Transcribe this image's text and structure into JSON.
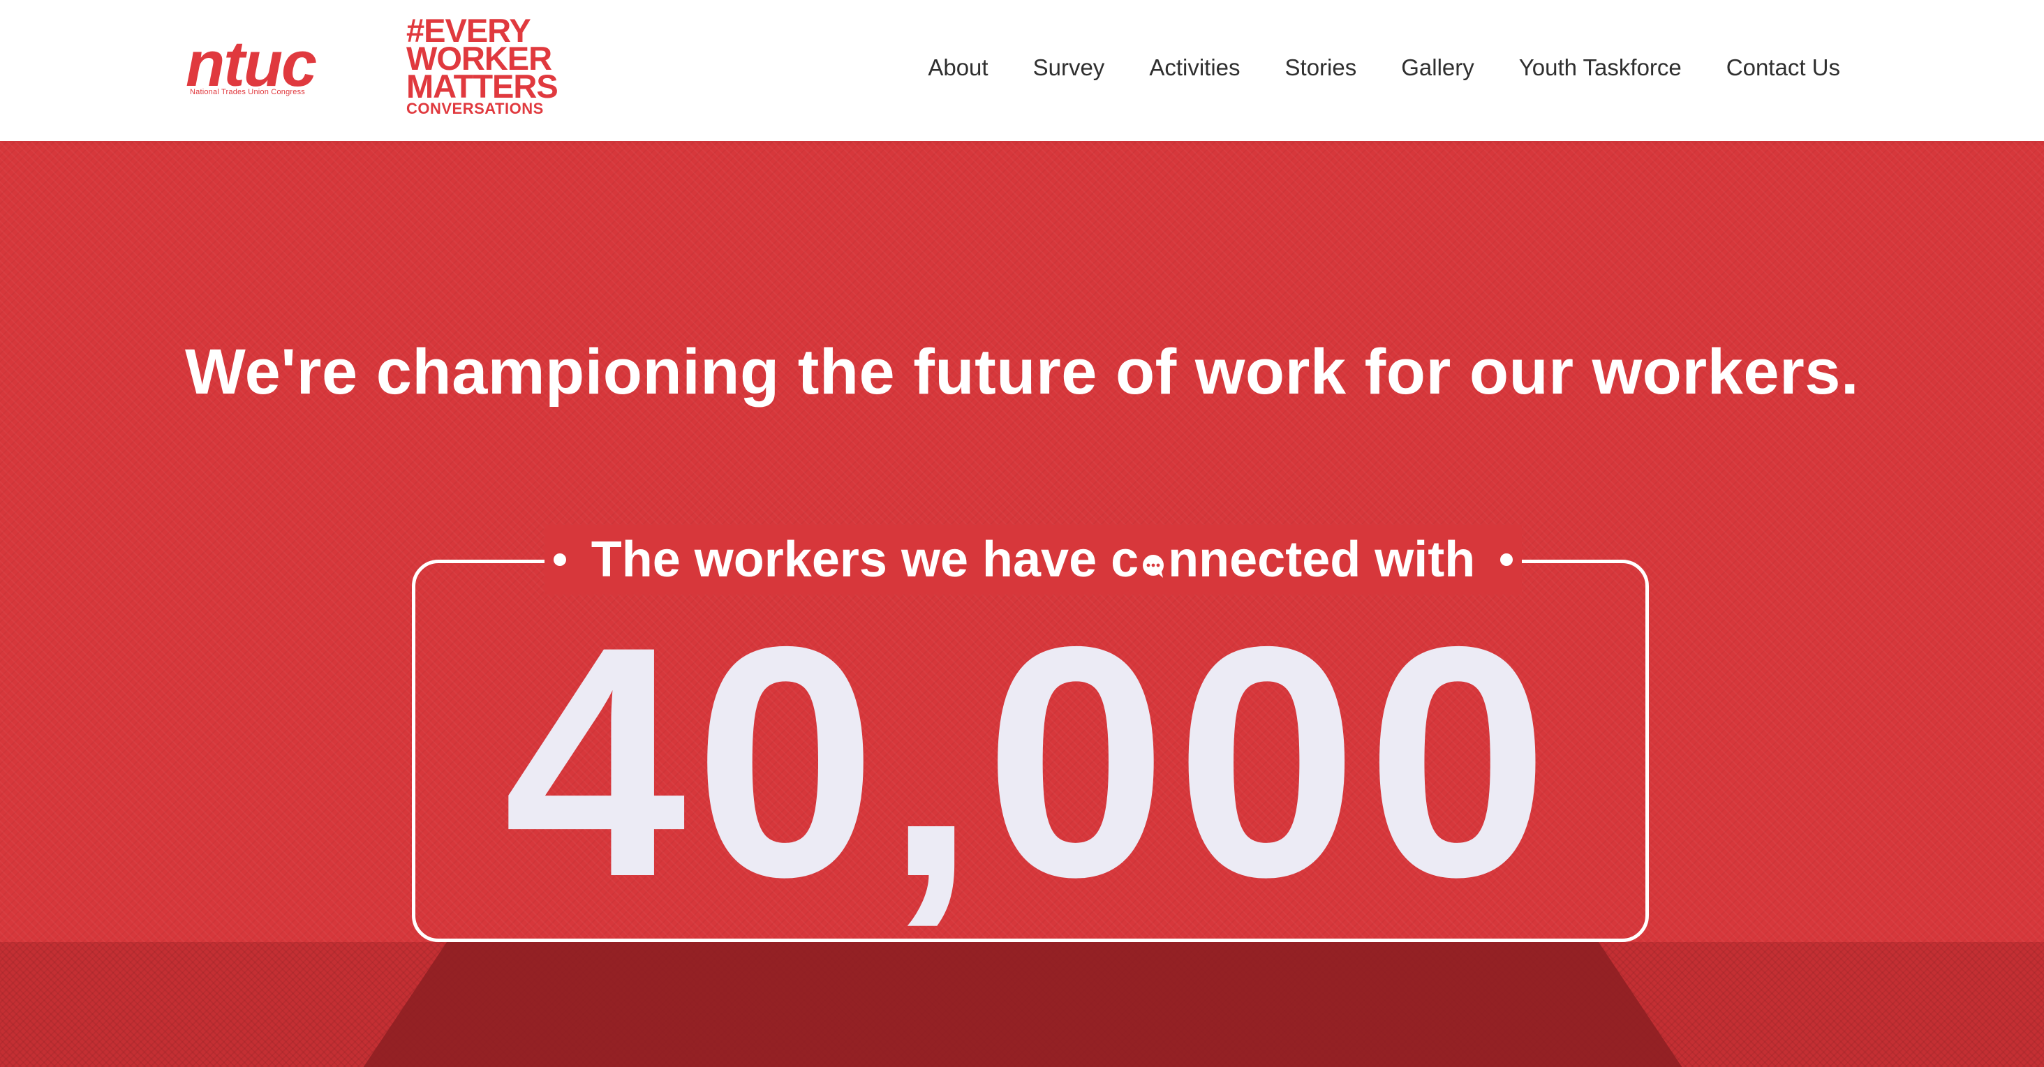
{
  "brand": {
    "ntuc_wordmark": "ntuc",
    "ntuc_tagline": "National Trades Union Congress",
    "campaign_lines": [
      "#EVERY",
      "WORKER",
      "MATTERS"
    ],
    "campaign_sub": "CONVERSATIONS"
  },
  "nav": {
    "items": [
      {
        "label": "About"
      },
      {
        "label": "Survey"
      },
      {
        "label": "Activities"
      },
      {
        "label": "Stories"
      },
      {
        "label": "Gallery"
      },
      {
        "label": "Youth Taskforce"
      },
      {
        "label": "Contact Us"
      }
    ]
  },
  "hero": {
    "headline": "We're championing the future of work for our workers.",
    "counter_caption_before": "The workers we have c",
    "counter_caption_after": "nnected with",
    "counter_value": "40,000"
  },
  "colors": {
    "brand_red": "#e0393e",
    "hero_red": "#d7373b",
    "counter_text": "#ecebf5",
    "nav_text": "#2f2f2f"
  },
  "icons": {
    "caption_icon": "chat-bubble-icon"
  }
}
